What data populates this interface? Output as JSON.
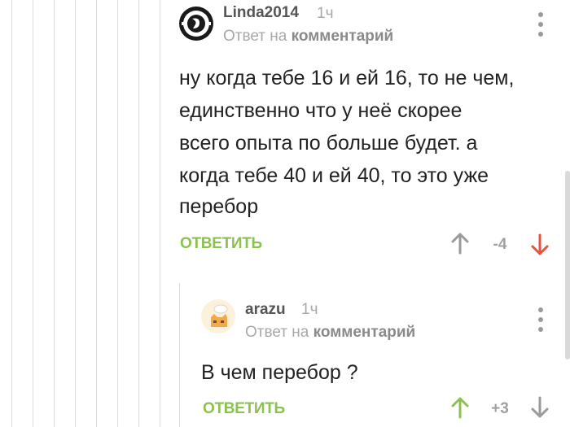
{
  "comments": [
    {
      "author": "Linda2014",
      "time": "1ч",
      "reply_prefix": "Ответ на",
      "reply_target": "комментарий",
      "body_lines": [
        "ну когда тебе 16 и ей 16, то не чем,",
        "единственно что у неё скорее",
        "всего опыта по больше будет. а",
        "когда тебе 40 и ей 40, то это уже",
        "перебор"
      ],
      "reply_label": "ОТВЕТИТЬ",
      "score": "-4",
      "vote_state": "downvoted",
      "colors": {
        "upvote": "#9a9a9a",
        "downvote": "#e8503f"
      }
    },
    {
      "author": "arazu",
      "time": "1ч",
      "reply_prefix": "Ответ на",
      "reply_target": "комментарий",
      "body_lines": [
        "В чем перебор ?"
      ],
      "reply_label": "ОТВЕТИТЬ",
      "score": "+3",
      "vote_state": "upvoted",
      "colors": {
        "upvote": "#8cc152",
        "downvote": "#9a9a9a"
      }
    }
  ],
  "icons": [
    "thread-line",
    "up-arrow-icon",
    "down-arrow-icon",
    "more-vert-icon",
    "avatar"
  ],
  "colors": {
    "accent": "#8cc152",
    "down_active": "#e8503f",
    "muted": "#a8a8a8"
  }
}
